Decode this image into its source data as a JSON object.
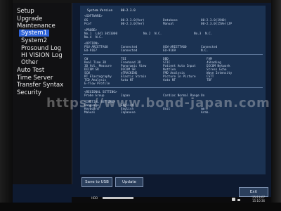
{
  "sidebar": {
    "items": [
      {
        "label": "Setup"
      },
      {
        "label": "Upgrade"
      },
      {
        "label": "Maintenance"
      },
      {
        "label": "System1",
        "selected": true
      },
      {
        "label": "System2"
      },
      {
        "label": "Prosound Log"
      },
      {
        "label": "HI VISION Log"
      },
      {
        "label": "Other"
      },
      {
        "label": "Auto Test"
      },
      {
        "label": "Time Server"
      },
      {
        "label": "Transfer Syntax"
      },
      {
        "label": "Security"
      }
    ]
  },
  "panel": {
    "system_version_label": "System Version",
    "system_version_value": "00-2.3.0",
    "software_header": "<SOFTWARE>",
    "software_rows": [
      {
        "c1": "OS",
        "c2": "00-2.3.0(Ver)",
        "c3": "Database",
        "c4": "00-2.3.0(1940)"
      },
      {
        "c1": "Pcof",
        "c2": "00-2.3.0(Ver)",
        "c3": "Manual",
        "c4": "00-2.3.0(15Ver)JP"
      }
    ],
    "probe_header": "<PROBE>",
    "probe_rows": [
      {
        "c1": "No.1",
        "c2": "L441 3051000",
        "c3": "No.2",
        "c4": "N.C.",
        "c5": "No.3",
        "c6": "N.C."
      },
      {
        "c1": "No.4",
        "c2": "N.C.",
        "c3": "",
        "c4": "",
        "c5": "",
        "c6": ""
      }
    ],
    "option_header": "<OPTION>",
    "option_rows": [
      {
        "c1": "PSU-ARIETTA60",
        "c2": "Connected",
        "c3": "UCW-ARIETTA60",
        "c4": "Connected"
      },
      {
        "c1": "EU-9167",
        "c2": "Connected",
        "c3": "EU-9169",
        "c4": "N.C."
      }
    ],
    "features": [
      [
        "CW",
        "TDI",
        "DBD",
        "FAM"
      ],
      [
        "Real Time 3D",
        "Freehand 3D",
        "STIC",
        "4Shading"
      ],
      [
        "3D Vol. Measure",
        "Panoramic View",
        "Patient Auto Input",
        "DICOM Network"
      ],
      [
        "DICOM SR",
        "DICOM SR",
        "Nuttlen",
        "Stress Echo"
      ],
      [
        "SCW",
        "eTRACKING",
        "FMD Analysis",
        "Wave Intensity"
      ],
      [
        "RT Elastography",
        "Elastic Strain",
        "Picture in Picture",
        "CSTT"
      ],
      [
        "TCD Analysis",
        "Auto NT",
        "Auto NT",
        "TDF"
      ],
      [
        "E-flow Profile",
        "",
        "",
        ""
      ]
    ],
    "regional_header": "<REGIONAL SETTING>",
    "regional_rows": [
      {
        "c1": "Probe Group",
        "c2": "Japan",
        "c3": "Cardiac Normal Range",
        "c4": "On"
      }
    ],
    "initial_header": "<INITIAL SETTING>",
    "initial_rows": [
      {
        "c1": "Language",
        "c2": "English",
        "c3": "",
        "c4": ""
      },
      {
        "c1": "Keyboard",
        "c2": "English",
        "c3": "Unit",
        "c4": "mm"
      },
      {
        "c1": "Manual",
        "c2": "Japanese",
        "c3": "",
        "c4": "Arab."
      }
    ]
  },
  "buttons": {
    "save_to_usb": "Save to USB",
    "update": "Update",
    "exit": "Exit"
  },
  "status": {
    "hdd_label": "HDD",
    "date": "'25/11/07",
    "time": "15:10:36"
  },
  "watermark": "https://www.bond-japan.com"
}
